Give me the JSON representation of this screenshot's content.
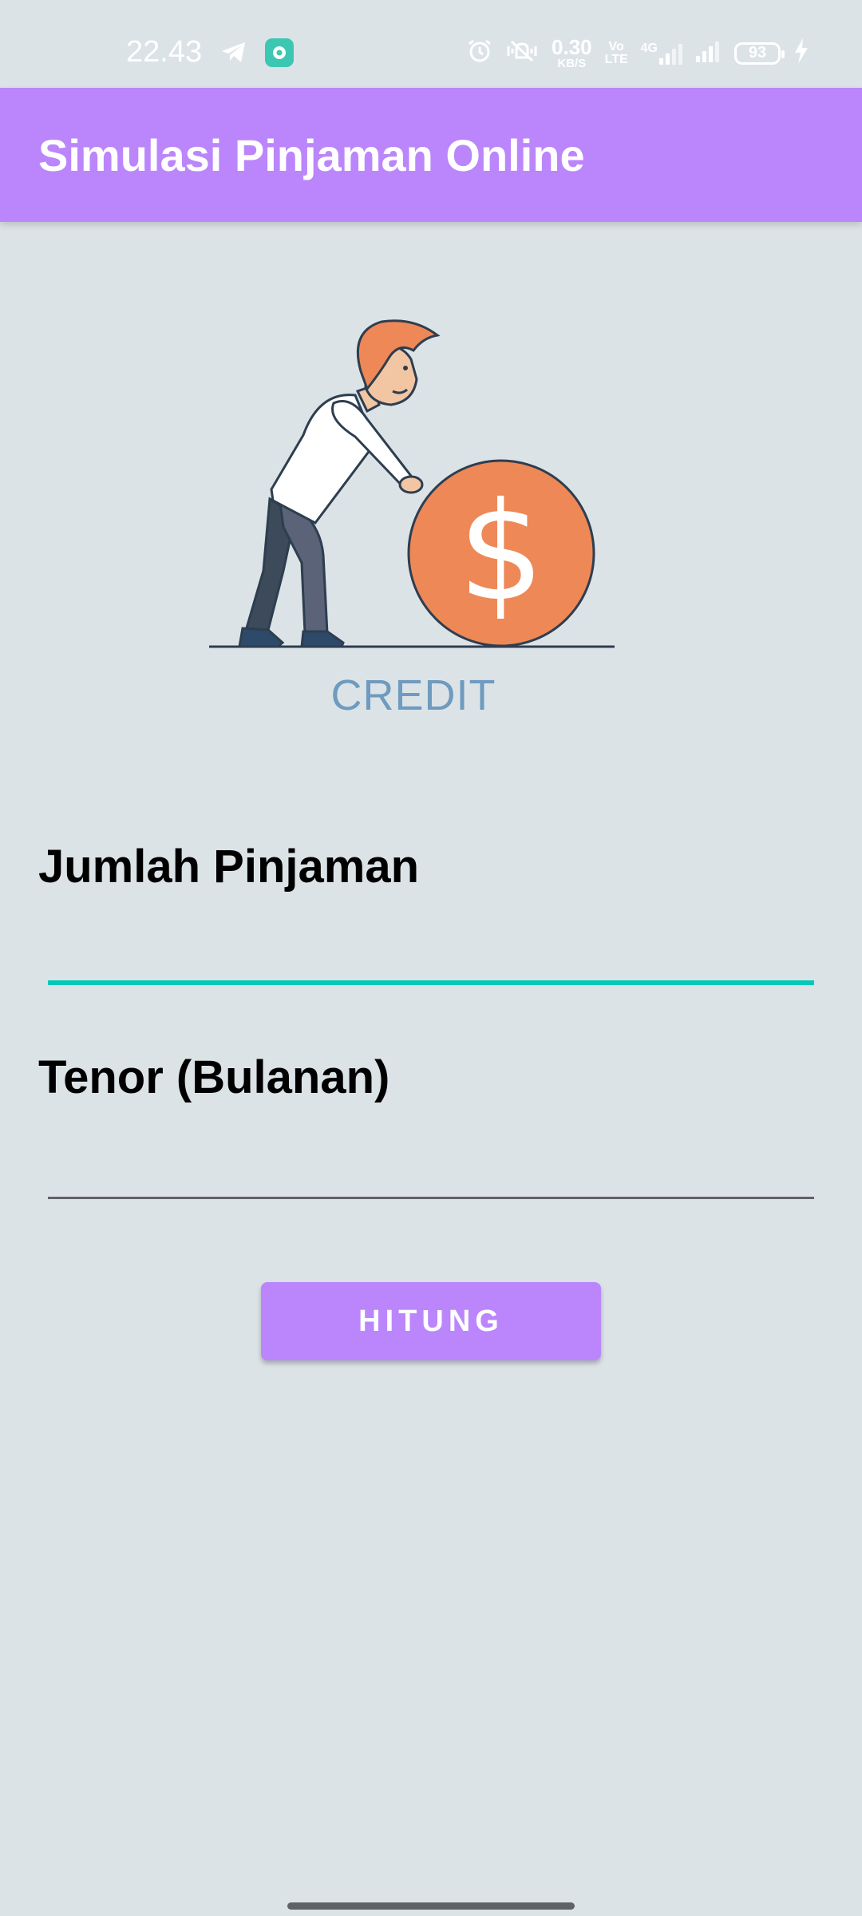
{
  "status_bar": {
    "time": "22.43",
    "net_speed_value": "0.30",
    "net_speed_unit": "KB/S",
    "volte_top": "Vo",
    "volte_bottom": "LTE",
    "network_type": "4G",
    "battery_level": "93",
    "icons": [
      "telegram-icon",
      "app-notification-icon",
      "alarm-icon",
      "mute-vibrate-icon",
      "signal-icon",
      "charging-icon"
    ]
  },
  "app_bar": {
    "title": "Simulasi Pinjaman Online"
  },
  "illustration": {
    "caption": "CREDIT",
    "coin_symbol": "$"
  },
  "form": {
    "loan_amount_label": "Jumlah Pinjaman",
    "loan_amount_value": "",
    "tenor_label": "Tenor (Bulanan)",
    "tenor_value": "",
    "submit_label": "HITUNG"
  },
  "colors": {
    "primary": "#bb86fc",
    "background": "#dce3e7",
    "focus_underline": "#00c9b7",
    "coin": "#ee8857",
    "caption": "#6e9bbf"
  }
}
